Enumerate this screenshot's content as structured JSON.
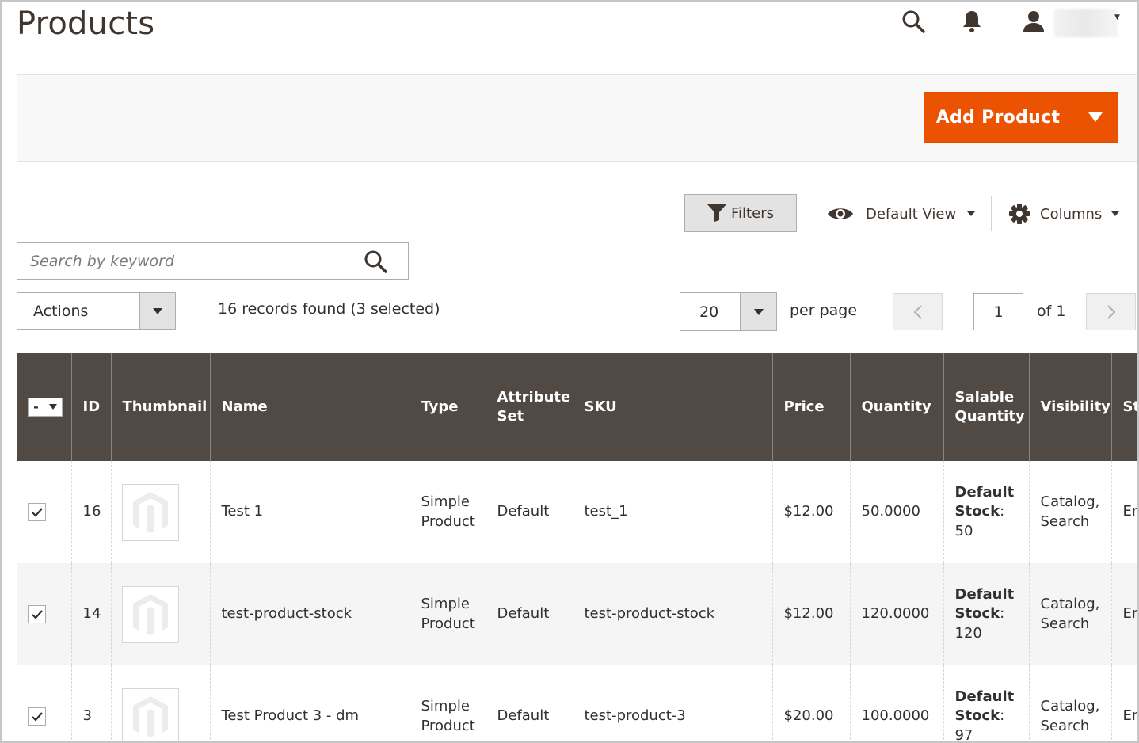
{
  "header": {
    "title": "Products"
  },
  "action_bar": {
    "add_product_label": "Add Product"
  },
  "toolbar": {
    "filters_label": "Filters",
    "view_label": "Default View",
    "columns_label": "Columns",
    "search_placeholder": "Search by keyword",
    "actions_label": "Actions",
    "records_text": "16 records found (3 selected)",
    "per_page_value": "20",
    "per_page_label": "per page",
    "current_page": "1",
    "of_pages": "of 1"
  },
  "grid": {
    "columns": [
      "ID",
      "Thumbnail",
      "Name",
      "Type",
      "Attribute Set",
      "SKU",
      "Price",
      "Quantity",
      "Salable Quantity",
      "Visibility",
      "St"
    ],
    "mass_select_symbol": "-",
    "rows": [
      {
        "id": "16",
        "name": "Test 1",
        "type": "Simple Product",
        "attribute_set": "Default",
        "sku": "test_1",
        "price": "$12.00",
        "quantity": "50.0000",
        "stock_label": "Default Stock",
        "stock_value": "50",
        "visibility": "Catalog, Search",
        "status": "En"
      },
      {
        "id": "14",
        "name": "test-product-stock",
        "type": "Simple Product",
        "attribute_set": "Default",
        "sku": "test-product-stock",
        "price": "$12.00",
        "quantity": "120.0000",
        "stock_label": "Default Stock",
        "stock_value": "120",
        "visibility": "Catalog, Search",
        "status": "En"
      },
      {
        "id": "3",
        "name": "Test Product 3 - dm",
        "type": "Simple Product",
        "attribute_set": "Default",
        "sku": "test-product-3",
        "price": "$20.00",
        "quantity": "100.0000",
        "stock_label": "Default Stock",
        "stock_value": "97",
        "visibility": "Catalog, Search",
        "status": "En"
      }
    ]
  },
  "colors": {
    "accent": "#eb5202",
    "header_bg": "#514943",
    "title": "#41362f"
  }
}
